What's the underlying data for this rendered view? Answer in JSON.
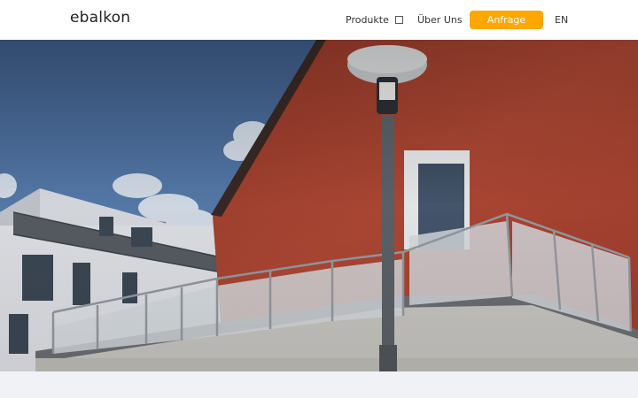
{
  "header": {
    "logo": "ebalkon",
    "nav": {
      "produkte": "Produkte",
      "produkte_icon": "chevron-down-icon",
      "ueber_uns": "Über Uns",
      "anfrage": "Anfrage",
      "language": "EN"
    }
  },
  "hero": {
    "image": "photo of a glass balcony railing on a red brick house with a street lamp"
  },
  "colors": {
    "accent": "#ffa600",
    "header_bg": "#ffffff",
    "page_bg": "#f1f2f5"
  }
}
